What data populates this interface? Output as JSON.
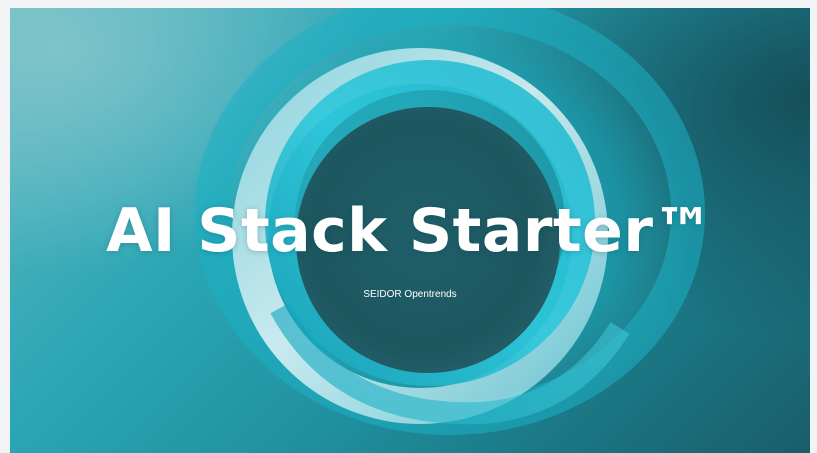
{
  "slide": {
    "title": "AI Stack Starter™",
    "subtitle": "SEIDOR Opentrends"
  },
  "colors": {
    "teal_light": "#5fb9c2",
    "teal_mid": "#2aa5b4",
    "teal_dark": "#195e6a",
    "ring_highlight": "#bfe9ef",
    "center_dark": "#1f5c66",
    "text": "#ffffff"
  }
}
